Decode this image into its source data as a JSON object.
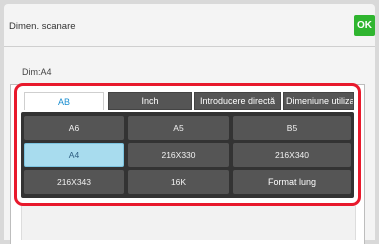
{
  "header": {
    "title": "Dimen. scanare",
    "ok_label": "OK"
  },
  "dim_label": "Dim:A4",
  "tabs": [
    {
      "label": "AB",
      "active": true
    },
    {
      "label": "Inch",
      "active": false
    },
    {
      "label": "Introducere directă",
      "active": false
    },
    {
      "label": "Dimeniune utilizator",
      "active": false
    }
  ],
  "sizes": [
    {
      "label": "A6",
      "selected": false
    },
    {
      "label": "A5",
      "selected": false
    },
    {
      "label": "B5",
      "selected": false
    },
    {
      "label": "A4",
      "selected": true
    },
    {
      "label": "216X330",
      "selected": false
    },
    {
      "label": "216X340",
      "selected": false
    },
    {
      "label": "216X343",
      "selected": false
    },
    {
      "label": "16K",
      "selected": false
    },
    {
      "label": "Format lung",
      "selected": false
    }
  ],
  "colors": {
    "ok_green": "#2fb52f",
    "highlight_red": "#e8192c",
    "selected_fill": "#a8dcee",
    "active_tab_text": "#1a8ed0"
  }
}
